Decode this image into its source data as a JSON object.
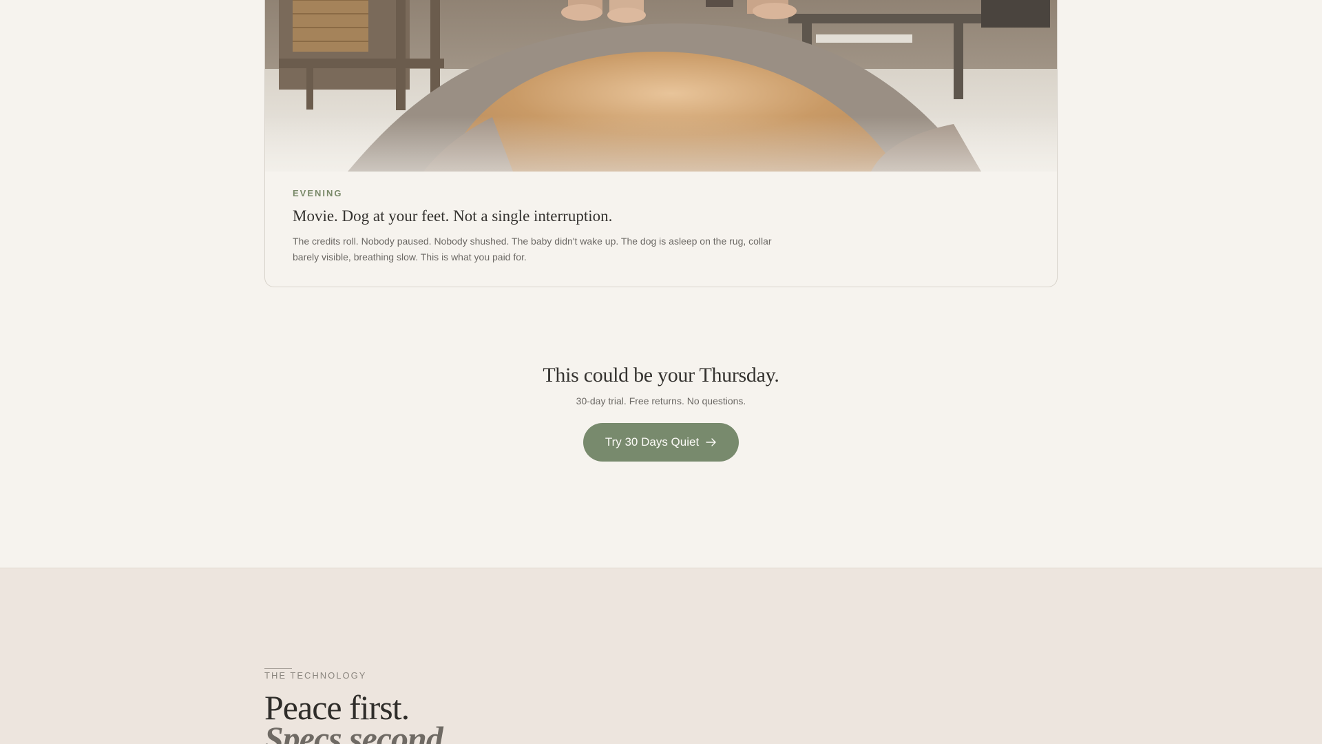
{
  "story": {
    "eyebrow": "EVENING",
    "title": "Movie. Dog at your feet. Not a single interruption.",
    "text": "The credits roll. Nobody paused. Nobody shushed. The baby didn't wake up. The dog is asleep on the rug, collar barely visible, breathing slow. This is what you paid for."
  },
  "cta": {
    "title": "This could be your Thursday.",
    "subtitle": "30-day trial. Free returns. No questions.",
    "button_label": "Try 30 Days Quiet",
    "button_icon": "arrow-right-icon",
    "button_color": "#788a6d"
  },
  "technology": {
    "eyebrow": "THE TECHNOLOGY",
    "heading": "Peace first.",
    "heading_italic": "Specs second."
  }
}
